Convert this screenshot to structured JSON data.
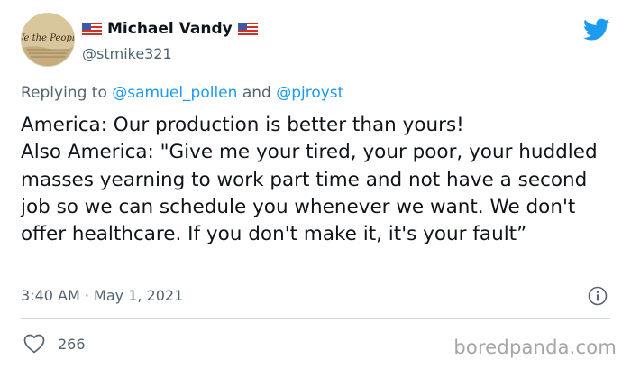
{
  "author": {
    "display_name": "Michael Vandy",
    "handle": "@stmike321",
    "avatar_text": "We the People",
    "avatar_icon": "constitution-avatar",
    "flag_icon": "us-flag-icon"
  },
  "reply": {
    "prefix": "Replying to ",
    "mention_1": "@samuel_pollen",
    "connector": " and ",
    "mention_2": "@pjroyst"
  },
  "tweet": {
    "text": "America: Our production is better than yours!\nAlso America: \"Give me your tired, your poor, your huddled masses yearning to work part time and not have a second job so we can schedule you whenever we want. We don't offer healthcare. If you don't make it, it's your fault”"
  },
  "meta": {
    "timestamp": "3:40 AM · May 1, 2021"
  },
  "actions": {
    "like_count": "266"
  },
  "watermark": "boredpanda.com",
  "colors": {
    "twitter_blue": "#1d9bf0",
    "secondary_text": "#536471",
    "divider": "#cfd9de"
  }
}
